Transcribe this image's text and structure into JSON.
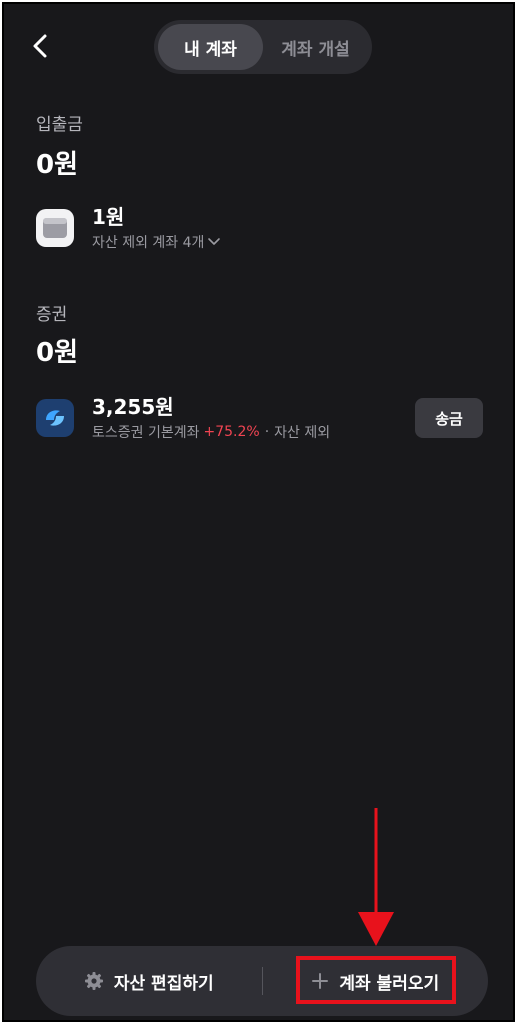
{
  "tabs": [
    {
      "label": "내 계좌",
      "active": true
    },
    {
      "label": "계좌 개설",
      "active": false
    }
  ],
  "deposits": {
    "label": "입출금",
    "total": "0원",
    "account": {
      "amount": "1원",
      "sub": "자산 제외 계좌 4개",
      "icon": "wallet-icon"
    }
  },
  "securities": {
    "label": "증권",
    "total": "0원",
    "account": {
      "amount": "3,255원",
      "name": "토스증권 기본계좌",
      "rate": "+75.2%",
      "excluded": "자산 제외",
      "send_label": "송금",
      "icon": "toss-securities-icon"
    }
  },
  "bottom_bar": {
    "edit_label": "자산 편집하기",
    "import_label": "계좌 불러오기"
  },
  "colors": {
    "background": "#18181b",
    "accent_red": "#f04452",
    "annotation": "#e8121c"
  }
}
